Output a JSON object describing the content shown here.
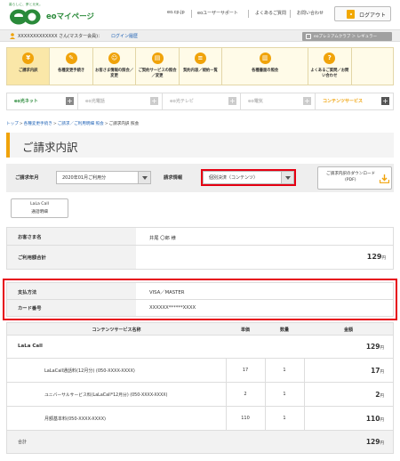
{
  "header": {
    "logo_tagline": "暮らしに、夢と元気。",
    "logo_text": "eo",
    "site_title": "eoマイページ",
    "nav": [
      "eo.cp.jp",
      "eoユーザーサポート",
      "よくあるご質問",
      "お問い合わせ"
    ],
    "logout_label": "ログアウト"
  },
  "user_bar": {
    "user_name": "XXXXXXXXXXXXX さん(マスター会員)：",
    "login_history": "ログイン履歴",
    "premium_label": "eoプレミアムクラブ ＞ レギュラー"
  },
  "menu": [
    {
      "label": "ご請求内訳",
      "icon": "yen-icon",
      "glyph": "¥",
      "active": true
    },
    {
      "label": "各種変更手続き",
      "icon": "pencil-icon",
      "glyph": "✎",
      "active": false
    },
    {
      "label": "お客さま情報の照会／変更",
      "icon": "person-icon",
      "glyph": "☺",
      "active": false
    },
    {
      "label": "ご契約サービスの照会／変更",
      "icon": "document-icon",
      "glyph": "▤",
      "active": false
    },
    {
      "label": "契約内容／規約一覧",
      "icon": "list-icon",
      "glyph": "≡",
      "active": false
    },
    {
      "label": "各種書面の照会",
      "icon": "document-icon",
      "glyph": "▥",
      "active": false
    },
    {
      "label": "よくあるご質問／お問い合わせ",
      "icon": "question-icon",
      "glyph": "?",
      "active": false
    }
  ],
  "services": [
    {
      "label": "eo光ネット",
      "dim": false
    },
    {
      "label": "eo光電話",
      "dim": true
    },
    {
      "label": "eo光テレビ",
      "dim": true
    },
    {
      "label": "eo電気",
      "dim": true
    },
    {
      "label": "コンテンツサービス",
      "dim": false
    }
  ],
  "breadcrumb": [
    "トップ",
    "各種変更手続き",
    "ご請求／ご利用明細 照会",
    "ご請求内訳 照会"
  ],
  "page_title": "ご請求内訳",
  "filter": {
    "month_label": "ご請求年月",
    "month_value": "2020年01月ご利用分",
    "info_label": "請求情報",
    "info_value": "個別決済（コンテンツ）",
    "pdf_label_1": "ご請求内訳のダウンロード",
    "pdf_label_2": "(PDF)"
  },
  "lala_button": {
    "line1": "LaLa Call",
    "line2": "通話明細"
  },
  "summary": {
    "name_label": "お客さま名",
    "name_value": "井尾 〇郎 様",
    "total_label": "ご利用額合計",
    "total_value": "129",
    "yen": "円"
  },
  "payment": {
    "method_label": "支払方法",
    "method_value": "VISA／MASTER",
    "card_label": "カード番号",
    "card_value": "XXXXXX******XXXX"
  },
  "detail": {
    "headers": [
      "コンテンツサービス名称",
      "単価",
      "数量",
      "金額"
    ],
    "group_name": "LaLa Call",
    "group_total": "129",
    "rows": [
      {
        "name": "LaLaCall通話料(12月分) (050-XXXX-XXXX)",
        "price": "17",
        "qty": "1",
        "amount": "17"
      },
      {
        "name": "ユニバーサルサービス料(LaLaCall*12月分) (050-XXXX-XXXX)",
        "price": "2",
        "qty": "1",
        "amount": "2"
      },
      {
        "name": "月額基本料(050-XXXX-XXXX)",
        "price": "110",
        "qty": "1",
        "amount": "110"
      }
    ],
    "total_label": "合計",
    "total_value": "129",
    "yen": "円"
  }
}
